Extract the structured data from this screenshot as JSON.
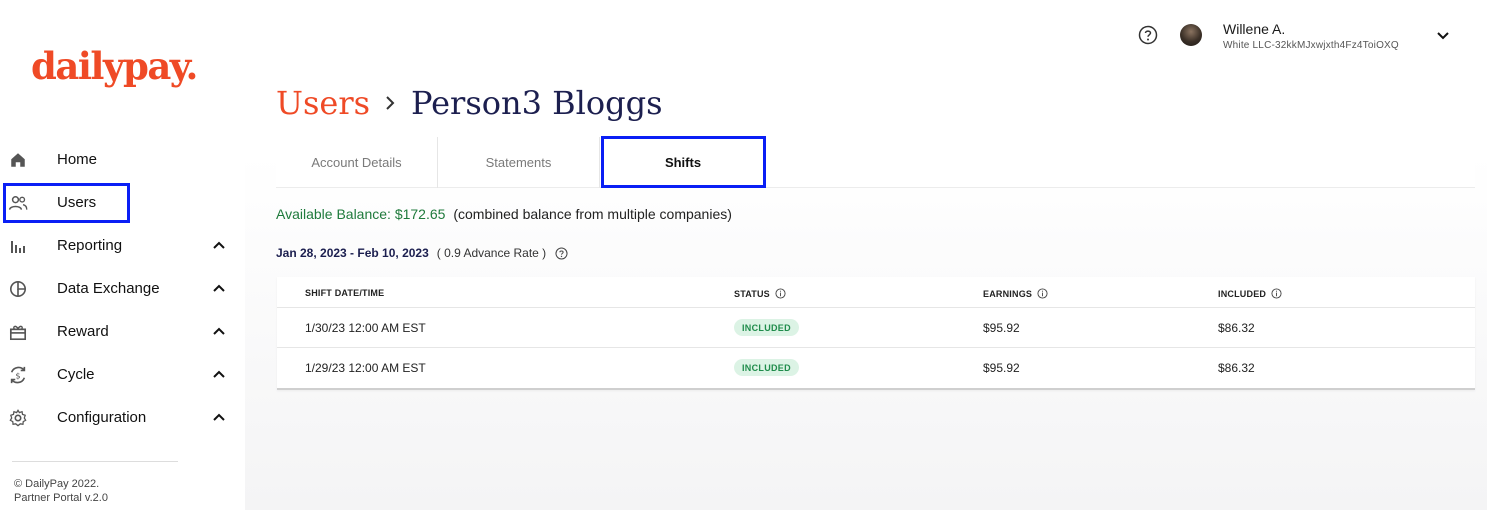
{
  "brand": {
    "logo_text": "dailypay."
  },
  "sidebar": {
    "items": [
      {
        "label": "Home",
        "icon": "home-icon",
        "expandable": false
      },
      {
        "label": "Users",
        "icon": "users-icon",
        "expandable": false
      },
      {
        "label": "Reporting",
        "icon": "bar-chart-icon",
        "expandable": true
      },
      {
        "label": "Data Exchange",
        "icon": "pie-chart-icon",
        "expandable": true
      },
      {
        "label": "Reward",
        "icon": "gift-icon",
        "expandable": true
      },
      {
        "label": "Cycle",
        "icon": "cycle-dollar-icon",
        "expandable": true
      },
      {
        "label": "Configuration",
        "icon": "gear-icon",
        "expandable": true
      }
    ],
    "footer": {
      "copyright": "© DailyPay 2022.",
      "version": "Partner Portal v.2.0"
    }
  },
  "header": {
    "user_name": "Willene A.",
    "user_company": "White LLC-32kkMJxwjxth4Fz4ToiOXQ"
  },
  "breadcrumb": {
    "parent": "Users",
    "current": "Person3 Bloggs"
  },
  "tabs": [
    {
      "label": "Account Details",
      "active": false
    },
    {
      "label": "Statements",
      "active": false
    },
    {
      "label": "Shifts",
      "active": true
    }
  ],
  "balance": {
    "label": "Available Balance: $172.65",
    "note": "(combined balance from multiple companies)"
  },
  "period": {
    "dates": "Jan 28, 2023 - Feb 10, 2023",
    "rate": "( 0.9 Advance Rate )"
  },
  "table": {
    "headers": [
      "SHIFT DATE/TIME",
      "STATUS",
      "EARNINGS",
      "INCLUDED"
    ],
    "rows": [
      {
        "datetime": "1/30/23 12:00 AM EST",
        "status": "INCLUDED",
        "earnings": "$95.92",
        "included": "$86.32"
      },
      {
        "datetime": "1/29/23 12:00 AM EST",
        "status": "INCLUDED",
        "earnings": "$95.92",
        "included": "$86.32"
      }
    ]
  },
  "colors": {
    "brand": "#ef4a26",
    "highlight": "#0a1ff5",
    "balance_green": "#1f7a3c",
    "badge_bg": "#dcf3e5",
    "badge_text": "#1f8c4b",
    "title_navy": "#1c1f4f"
  }
}
